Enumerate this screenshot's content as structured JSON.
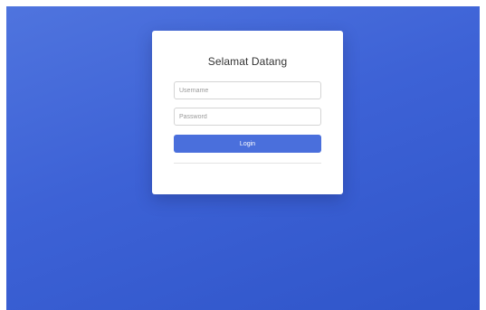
{
  "login": {
    "title": "Selamat Datang",
    "username_placeholder": "Username",
    "username_value": "",
    "password_placeholder": "Password",
    "password_value": "",
    "login_label": "Login"
  },
  "colors": {
    "background_gradient_start": "#4f74de",
    "background_gradient_end": "#2f55c9",
    "button": "#4a6fdc",
    "card": "#ffffff"
  }
}
